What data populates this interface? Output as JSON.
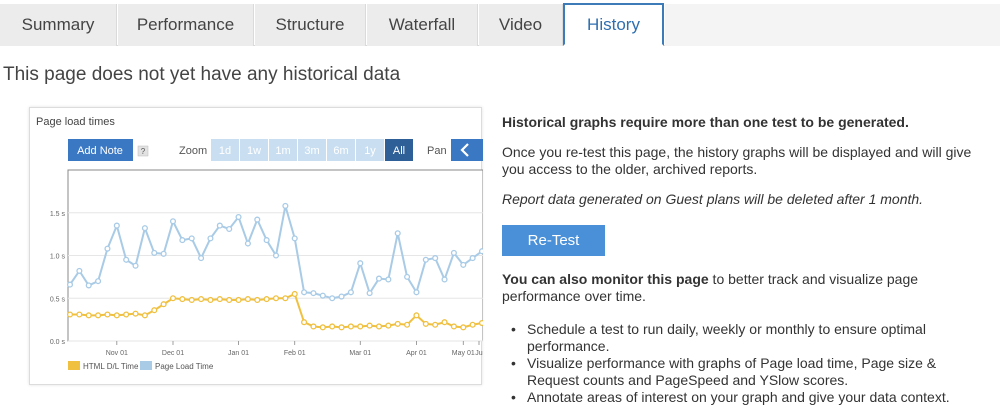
{
  "tabs": [
    {
      "label": "Summary"
    },
    {
      "label": "Performance"
    },
    {
      "label": "Structure"
    },
    {
      "label": "Waterfall"
    },
    {
      "label": "Video"
    },
    {
      "label": "History",
      "active": true
    }
  ],
  "page_title": "This page does not yet have any historical data",
  "chart_widget": {
    "title": "Page load times",
    "add_note_label": "Add Note",
    "help_label": "?",
    "zoom_label": "Zoom",
    "zoom_options": [
      "1d",
      "1w",
      "1m",
      "3m",
      "6m",
      "1y",
      "All"
    ],
    "zoom_selected": "All",
    "pan_label": "Pan",
    "pan_icon": "chevron-left-icon"
  },
  "chart_data": {
    "type": "line",
    "title": "Page load times",
    "ylim": [
      0,
      2.0
    ],
    "y_ticks": [
      "0.0 s",
      "0.5 s",
      "1.0 s",
      "1.5 s"
    ],
    "x_ticks": [
      "Nov 01",
      "Dec 01",
      "Jan 01",
      "Feb 01",
      "Mar 01",
      "Apr 01",
      "May 01",
      "Ju"
    ],
    "grid": true,
    "legend_position": "bottom-left",
    "series": [
      {
        "name": "HTML D/L Time",
        "color": "#f0c040",
        "values": [
          0.31,
          0.31,
          0.3,
          0.3,
          0.31,
          0.3,
          0.31,
          0.32,
          0.3,
          0.36,
          0.43,
          0.5,
          0.49,
          0.48,
          0.49,
          0.48,
          0.49,
          0.48,
          0.48,
          0.49,
          0.48,
          0.49,
          0.5,
          0.5,
          0.55,
          0.22,
          0.17,
          0.16,
          0.17,
          0.16,
          0.17,
          0.17,
          0.18,
          0.17,
          0.18,
          0.2,
          0.19,
          0.3,
          0.2,
          0.19,
          0.22,
          0.17,
          0.16,
          0.19,
          0.21
        ]
      },
      {
        "name": "Page Load Time",
        "color": "#a9cbe6",
        "values": [
          0.66,
          0.82,
          0.65,
          0.7,
          1.08,
          1.35,
          0.95,
          0.88,
          1.32,
          1.03,
          1.02,
          1.4,
          1.18,
          1.2,
          0.97,
          1.2,
          1.35,
          1.31,
          1.45,
          1.14,
          1.42,
          1.18,
          1.0,
          1.58,
          1.2,
          0.57,
          0.56,
          0.53,
          0.5,
          0.52,
          0.57,
          0.91,
          0.56,
          0.73,
          0.72,
          1.26,
          0.75,
          0.57,
          0.95,
          0.97,
          0.72,
          1.03,
          0.89,
          0.97,
          1.05
        ]
      }
    ]
  },
  "info": {
    "lead": "Historical graphs require more than one test to be generated.",
    "body": "Once you re-test this page, the history graphs will be displayed and will give you access to the older, archived reports.",
    "note": "Report data generated on Guest plans will be deleted after 1 month.",
    "retest_label": "Re-Test",
    "monitor_bold": "You can also monitor this page",
    "monitor_rest": " to better track and visualize page performance over time.",
    "bullets": [
      "Schedule a test to run daily, weekly or monthly to ensure optimal performance.",
      "Visualize performance with graphs of Page load time, Page size & Request counts and PageSpeed and YSlow scores.",
      "Annotate areas of interest on your graph and give your data context."
    ]
  },
  "colors": {
    "accent": "#3d7ab8",
    "button": "#4a90d9",
    "zoom_active": "#2e5f96",
    "zoom_inactive": "#c9dff1"
  }
}
